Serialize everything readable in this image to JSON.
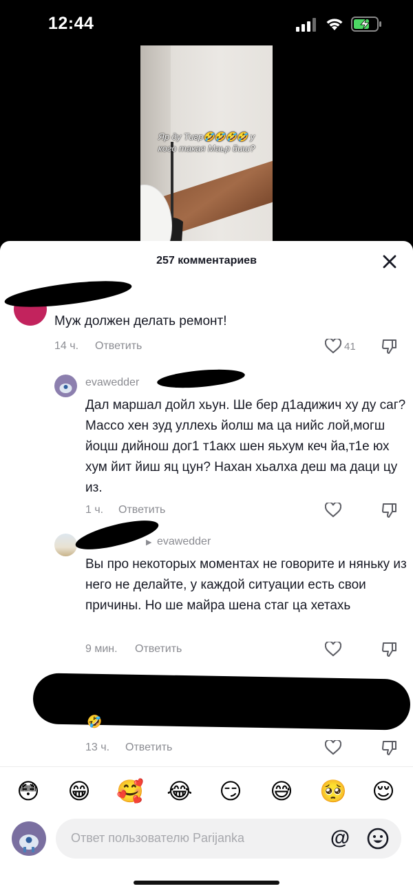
{
  "status_bar": {
    "time": "12:44"
  },
  "video": {
    "caption": "Яр ду Тигр🤣🤣🤣🤣 у кого такая Маьр йиш?"
  },
  "comments_sheet": {
    "title": "257 комментариев",
    "comments": [
      {
        "username": "",
        "text": "Муж должен делать ремонт!",
        "time": "14 ч.",
        "reply_label": "Ответить",
        "likes": "41"
      },
      {
        "username": "evawedder",
        "text": "Дал маршал дойл хьун. Ше бер д1адижич ху ду саг? Массо хен зуд уллехь йолш ма ца нийс лой,могш йоцш дийнош дог1 т1акх шен яьхум кеч йа,т1е юх хум йит йиш яц цун? Нахан хьалха деш ма даци цу из.",
        "time": "1 ч.",
        "reply_label": "Ответить"
      },
      {
        "reply_to": "evawedder",
        "text": "Вы про некоторых моментах не говорите и няньку из него не делайте, у каждой ситуации есть свои причины. Но ше майра шена стаг ца хетахь",
        "time": "9 мин.",
        "reply_label": "Ответить"
      },
      {
        "text": "",
        "time": "13 ч.",
        "reply_label": "Ответить"
      }
    ]
  },
  "emoji_bar": [
    "😳",
    "😁",
    "🥰",
    "😂",
    "😏",
    "😅",
    "🥺",
    "😌"
  ],
  "reply_input": {
    "placeholder": "Ответ пользователю Parijanka",
    "at_symbol": "@"
  }
}
